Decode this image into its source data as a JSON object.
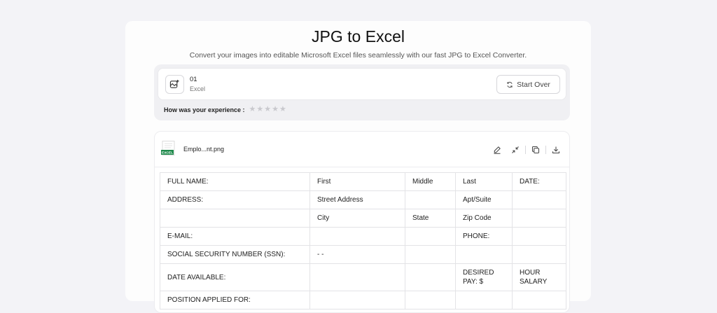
{
  "page": {
    "title": "JPG to Excel",
    "subtitle": "Convert your images into editable Microsoft Excel files seamlessly with our fast JPG to Excel Converter."
  },
  "upload": {
    "file_count": "01",
    "file_type": "Excel",
    "start_over_label": "Start Over",
    "experience_label": "How was your experience :",
    "rating": 0,
    "rating_max": 5
  },
  "result": {
    "thumb_badge": "EXCEL",
    "file_name": "Emplo...nt.png"
  },
  "sheet": {
    "rows": [
      [
        "FULL NAME:",
        "First",
        "Middle",
        "Last",
        "DATE:"
      ],
      [
        "ADDRESS:",
        "Street Address",
        "",
        "Apt/Suite",
        ""
      ],
      [
        "",
        "City",
        "State",
        "Zip Code",
        ""
      ],
      [
        "E-MAIL:",
        "",
        "",
        "PHONE:",
        ""
      ],
      [
        "SOCIAL SECURITY NUMBER (SSN):",
        "- -",
        "",
        "",
        ""
      ],
      [
        "DATE AVAILABLE:",
        "",
        "",
        "DESIRED\nPAY: $",
        "HOUR\nSALARY"
      ],
      [
        "POSITION APPLIED FOR:",
        "",
        "",
        "",
        ""
      ]
    ]
  }
}
